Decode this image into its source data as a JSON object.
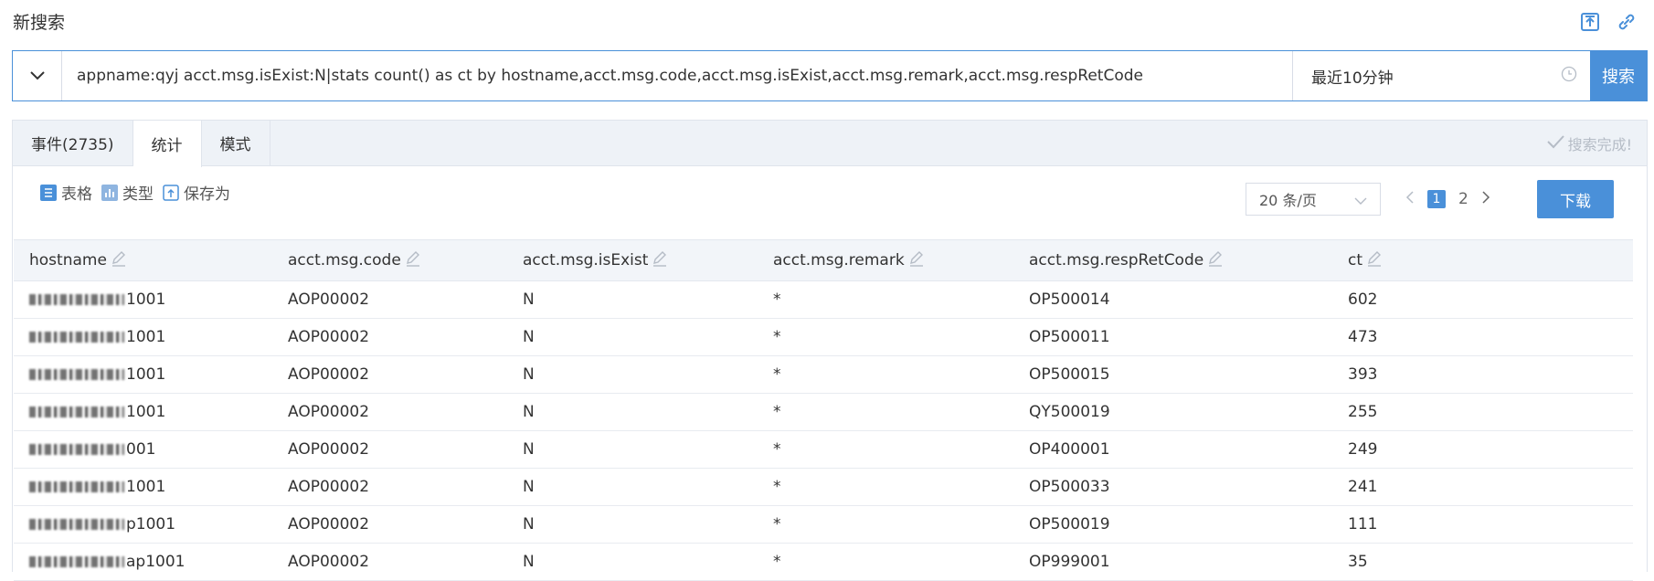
{
  "page": {
    "title": "新搜索"
  },
  "search": {
    "query": "appname:qyj acct.msg.isExist:N|stats count() as ct by hostname,acct.msg.code,acct.msg.isExist,acct.msg.remark,acct.msg.respRetCode",
    "time_range": "最近10分钟",
    "button": "搜索"
  },
  "tabs": [
    {
      "label": "事件(2735)"
    },
    {
      "label": "统计"
    },
    {
      "label": "模式"
    }
  ],
  "status": "搜索完成!",
  "toolbar": {
    "table_label": "表格",
    "type_label": "类型",
    "saveas_label": "保存为",
    "page_size": "20 条/页",
    "pages": [
      "1",
      "2"
    ],
    "current_page": "1",
    "download": "下载"
  },
  "table": {
    "columns": [
      "hostname",
      "acct.msg.code",
      "acct.msg.isExist",
      "acct.msg.remark",
      "acct.msg.respRetCode",
      "ct"
    ],
    "rows": [
      [
        "1001",
        "AOP00002",
        "N",
        "*",
        "OP500014",
        "602"
      ],
      [
        "1001",
        "AOP00002",
        "N",
        "*",
        "OP500011",
        "473"
      ],
      [
        "1001",
        "AOP00002",
        "N",
        "*",
        "OP500015",
        "393"
      ],
      [
        "1001",
        "AOP00002",
        "N",
        "*",
        "QY500019",
        "255"
      ],
      [
        "001",
        "AOP00002",
        "N",
        "*",
        "OP400001",
        "249"
      ],
      [
        "1001",
        "AOP00002",
        "N",
        "*",
        "OP500033",
        "241"
      ],
      [
        "p1001",
        "AOP00002",
        "N",
        "*",
        "OP500019",
        "111"
      ],
      [
        "ap1001",
        "AOP00002",
        "N",
        "*",
        "OP999001",
        "35"
      ]
    ]
  },
  "colors": {
    "accent": "#4a90d9",
    "border": "#dfe4ec",
    "header_bg": "#f2f5f9"
  }
}
